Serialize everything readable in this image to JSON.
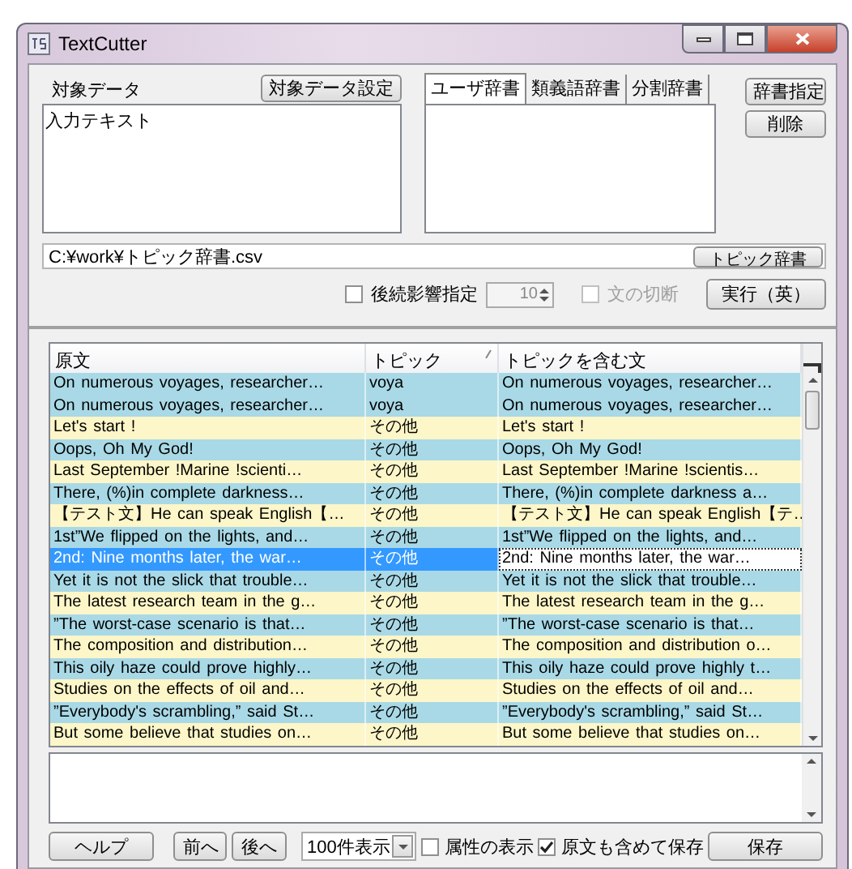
{
  "window": {
    "title": "TextCutter"
  },
  "target": {
    "label": "対象データ",
    "button": "対象データ設定",
    "text": "入力テキスト"
  },
  "dictionary_tabs": [
    {
      "label": "ユーザ辞書",
      "selected": true
    },
    {
      "label": "類義語辞書",
      "selected": false
    },
    {
      "label": "分割辞書",
      "selected": false
    }
  ],
  "dictionary_buttons": [
    "辞書指定",
    "削除"
  ],
  "topic_file": {
    "value": "C:¥work¥トピック辞書.csv",
    "button": "トピック辞書"
  },
  "options": {
    "follow_label": "後続影響指定",
    "follow_checked": false,
    "count": "10",
    "split_label": "文の切断",
    "split_checked": false,
    "split_disabled": true,
    "run_button": "実行（英）"
  },
  "table": {
    "columns": [
      {
        "label": "原文",
        "sorted": false
      },
      {
        "label": "トピック",
        "sorted": true
      },
      {
        "label": "トピックを含む文",
        "sorted": false
      }
    ],
    "rows": [
      {
        "original": "On numerous voyages, researcher…",
        "topic": "voya",
        "sentence": "On numerous voyages, researcher…",
        "color": "#a9d9e6",
        "selected": false
      },
      {
        "original": "On numerous voyages, researcher…",
        "topic": "voya",
        "sentence": "On numerous voyages, researcher…",
        "color": "#a9d9e6",
        "selected": false
      },
      {
        "original": "Let's start !",
        "topic": "その他",
        "sentence": "Let's start !",
        "color": "#fdf6c8",
        "selected": false
      },
      {
        "original": "Oops, Oh My God!",
        "topic": "その他",
        "sentence": "Oops, Oh My God!",
        "color": "#a9d9e6",
        "selected": false
      },
      {
        "original": "Last September !Marine !scienti…",
        "topic": "その他",
        "sentence": "Last September !Marine !scientis…",
        "color": "#fdf6c8",
        "selected": false
      },
      {
        "original": "There, (%)in complete darkness…",
        "topic": "その他",
        "sentence": "There, (%)in complete darkness a…",
        "color": "#a9d9e6",
        "selected": false
      },
      {
        "original": "【テスト文】He can speak English【…",
        "topic": "その他",
        "sentence": "【テスト文】He can speak English【テ…",
        "color": "#fdf6c8",
        "selected": false
      },
      {
        "original": "1st”We flipped on the lights, and…",
        "topic": "その他",
        "sentence": "1st”We flipped on the lights, and…",
        "color": "#a9d9e6",
        "selected": false
      },
      {
        "original": "2nd: Nine months later, the war…",
        "topic": "その他",
        "sentence": "2nd: Nine months later, the war…",
        "selected": true
      },
      {
        "original": "Yet it is not the slick that trouble…",
        "topic": "その他",
        "sentence": "Yet it is not the slick that trouble…",
        "color": "#a9d9e6",
        "selected": false
      },
      {
        "original": "The latest research team in the g…",
        "topic": "その他",
        "sentence": "The latest research team in the g…",
        "color": "#fdf6c8",
        "selected": false
      },
      {
        "original": "”The worst-case scenario is that…",
        "topic": "その他",
        "sentence": "”The worst-case scenario is that…",
        "color": "#a9d9e6",
        "selected": false
      },
      {
        "original": "The composition and distribution…",
        "topic": "その他",
        "sentence": "The composition and distribution o…",
        "color": "#fdf6c8",
        "selected": false
      },
      {
        "original": "This oily haze could prove highly…",
        "topic": "その他",
        "sentence": "This oily haze could prove highly t…",
        "color": "#a9d9e6",
        "selected": false
      },
      {
        "original": "Studies on the effects of oil and…",
        "topic": "その他",
        "sentence": "Studies on the effects of oil and…",
        "color": "#fdf6c8",
        "selected": false
      },
      {
        "original": "”Everybody's scrambling,” said St…",
        "topic": "その他",
        "sentence": "”Everybody's scrambling,” said St…",
        "color": "#a9d9e6",
        "selected": false
      },
      {
        "original": "But some believe that studies on…",
        "topic": "その他",
        "sentence": "But some believe that studies on…",
        "color": "#fdf6c8",
        "selected": false
      }
    ]
  },
  "bottom_bar": {
    "help_button": "ヘルプ",
    "prev_button": "前へ",
    "next_button": "後へ",
    "page_size": "100件表示",
    "checkboxes": [
      {
        "label": "属性の表示",
        "checked": false
      },
      {
        "label": "原文も含めて保存",
        "checked": true
      }
    ],
    "save_button": "保存"
  }
}
